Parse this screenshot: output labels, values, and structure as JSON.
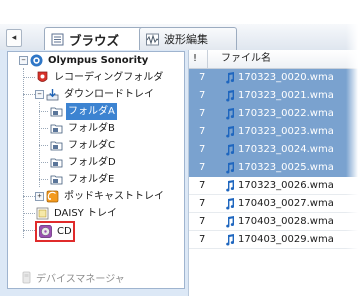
{
  "toolbar": {
    "back_glyph": "◂",
    "tabs": [
      {
        "label": "ブラウズ",
        "icon": "browse-list-icon",
        "active": true
      },
      {
        "label": "波形編集",
        "icon": "waveform-icon",
        "active": false
      }
    ]
  },
  "tree": {
    "root": {
      "label": "Olympus Sonority",
      "icon": "sonority-logo-icon",
      "expander": "−"
    },
    "items": [
      {
        "label": "レコーディングフォルダ",
        "icon": "recording-folder-icon"
      },
      {
        "label": "ダウンロードトレイ",
        "icon": "download-tray-icon",
        "expander": "−"
      },
      {
        "label": "フォルダA",
        "icon": "folder-icon",
        "selected": true
      },
      {
        "label": "フォルダB",
        "icon": "folder-icon"
      },
      {
        "label": "フォルダC",
        "icon": "folder-icon"
      },
      {
        "label": "フォルダD",
        "icon": "folder-icon"
      },
      {
        "label": "フォルダE",
        "icon": "folder-icon"
      },
      {
        "label": "ポッドキャストトレイ",
        "icon": "podcast-tray-icon",
        "expander": "+"
      },
      {
        "label": "DAISY トレイ",
        "icon": "daisy-tray-icon"
      },
      {
        "label": "CD",
        "icon": "cd-icon",
        "highlighted": true
      }
    ]
  },
  "device_manager": {
    "label": "デバイスマネージャ",
    "icon": "device-manager-icon"
  },
  "file_list": {
    "columns": [
      "!",
      "ファイル名"
    ],
    "rows": [
      {
        "num": "7",
        "name": "170323_0020.wma",
        "selected": true
      },
      {
        "num": "7",
        "name": "170323_0021.wma",
        "selected": true
      },
      {
        "num": "7",
        "name": "170323_0022.wma",
        "selected": true
      },
      {
        "num": "7",
        "name": "170323_0023.wma",
        "selected": true
      },
      {
        "num": "7",
        "name": "170323_0024.wma",
        "selected": true
      },
      {
        "num": "7",
        "name": "170323_0025.wma",
        "selected": true
      },
      {
        "num": "7",
        "name": "170323_0026.wma",
        "selected": false
      },
      {
        "num": "7",
        "name": "170403_0027.wma",
        "selected": false
      },
      {
        "num": "7",
        "name": "170403_0028.wma",
        "selected": false
      },
      {
        "num": "7",
        "name": "170403_0029.wma",
        "selected": false
      }
    ]
  },
  "colors": {
    "selection": "#3c83d1",
    "row_selection": "#7aa2cf",
    "highlight_box": "#e02b2b"
  }
}
